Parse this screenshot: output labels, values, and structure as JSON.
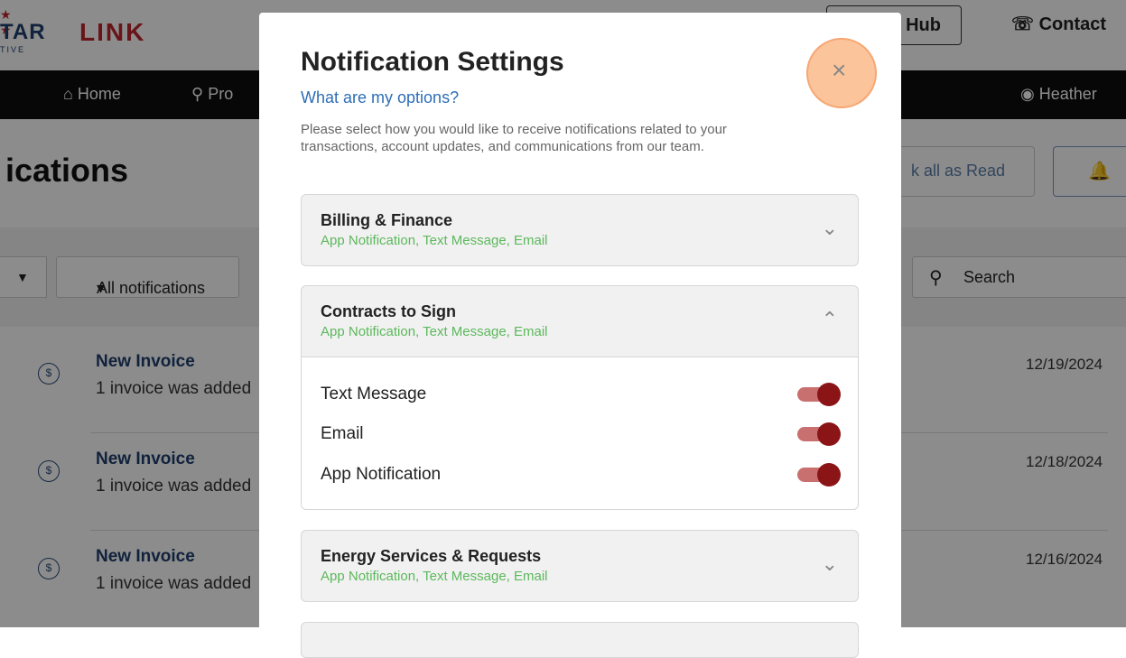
{
  "logo": {
    "star_text": "★ ★",
    "left_text": "TAR",
    "right_text": "LINK",
    "sub_text": "TIVE"
  },
  "header": {
    "hub_label": "Hub",
    "contact_label": "Contact",
    "contact_icon": "phone-icon"
  },
  "nav": {
    "home_label": "Home",
    "products_label": "Pro",
    "user_label": "Heather"
  },
  "page": {
    "title": "ications"
  },
  "actions": {
    "mark_all_read": "k all as Read"
  },
  "filters": {
    "all_label": "All notifications",
    "search_label": "Search"
  },
  "notifications": [
    {
      "title": "New Invoice",
      "desc": "1 invoice was added",
      "date": "12/19/2024"
    },
    {
      "title": "New Invoice",
      "desc": "1 invoice was added",
      "date": "12/18/2024"
    },
    {
      "title": "New Invoice",
      "desc": "1 invoice was added",
      "date": "12/16/2024"
    }
  ],
  "modal": {
    "title": "Notification Settings",
    "options_link": "What are my options?",
    "intro": "Please select how you would like to receive notifications related to your transactions, account updates, and communications from our team.",
    "close_symbol": "×",
    "sections": [
      {
        "title": "Billing & Finance",
        "subtitle": "App Notification, Text Message, Email",
        "expanded": false
      },
      {
        "title": "Contracts to Sign",
        "subtitle": "App Notification, Text Message, Email",
        "expanded": true,
        "options": [
          {
            "label": "Text Message",
            "enabled": true
          },
          {
            "label": "Email",
            "enabled": true
          },
          {
            "label": "App Notification",
            "enabled": true
          }
        ]
      },
      {
        "title": "Energy Services & Requests",
        "subtitle": "App Notification, Text Message, Email",
        "expanded": false
      }
    ]
  },
  "colors": {
    "accent_red": "#8b1417",
    "link_blue": "#2e6eb5",
    "success_green": "#5cb85c",
    "highlight_orange": "#fbc49b"
  }
}
